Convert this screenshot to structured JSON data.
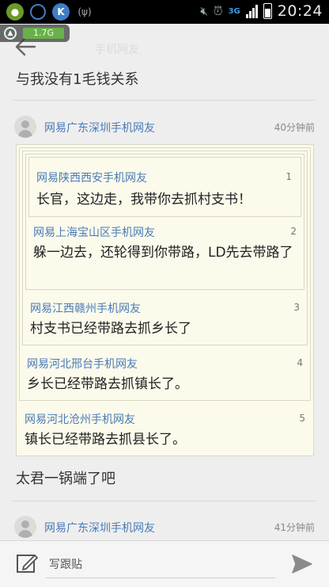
{
  "status_bar": {
    "time": "20:24",
    "network_label": "3G",
    "icons": [
      "360-icon",
      "headset-icon",
      "k-icon",
      "wifi-antenna-icon",
      "mute-icon",
      "alarm-icon",
      "signal-icon",
      "battery-icon"
    ]
  },
  "memory_widget": {
    "value": "1.7G"
  },
  "header": {
    "title": "手机网友"
  },
  "thread": {
    "post1_text": "与我没有1毛钱关系",
    "comment": {
      "author": "网易广东深圳手机网友",
      "time": "40分钟前",
      "quotes": [
        {
          "floor": "1",
          "author": "网易陕西西安手机网友",
          "text": "长官，这边走，我带你去抓村支书！"
        },
        {
          "floor": "2",
          "author": "网易上海宝山区手机网友",
          "text": "躲一边去，还轮得到你带路，LD先去带路了"
        },
        {
          "floor": "3",
          "author": "网易江西赣州手机网友",
          "text": "村支书已经带路去抓乡长了"
        },
        {
          "floor": "4",
          "author": "网易河北邢台手机网友",
          "text": "乡长已经带路去抓镇长了。"
        },
        {
          "floor": "5",
          "author": "网易河北沧州手机网友",
          "text": "镇长已经带路去抓县长了。"
        }
      ],
      "reply_text": "太君一锅端了吧"
    },
    "next_comment": {
      "author": "网易广东深圳手机网友",
      "time": "41分钟前"
    }
  },
  "bottom_bar": {
    "placeholder": "写跟贴"
  },
  "colors": {
    "link_blue": "#4a7bb7",
    "quote_bg": "#fbfaeb",
    "memory_green": "#6ab04c"
  }
}
